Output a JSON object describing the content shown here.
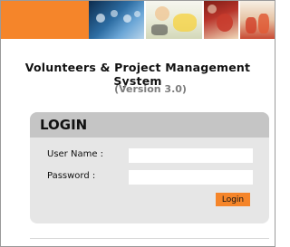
{
  "banner": {
    "accent_color": "#f5852a",
    "images": [
      "lab-glassware-photo",
      "scientist-microscope-photo",
      "chemistry-flask-photo",
      "chemistry-bottles-photo"
    ]
  },
  "app": {
    "title": "Volunteers & Project Management System",
    "version": "(Version 3.0)"
  },
  "login": {
    "header": "LOGIN",
    "username_label": "User Name :",
    "username_value": "",
    "password_label": "Password :",
    "password_value": "",
    "submit_label": "Login",
    "button_color": "#f5852a",
    "panel_color": "#e6e6e6",
    "header_color": "#c5c5c5"
  }
}
